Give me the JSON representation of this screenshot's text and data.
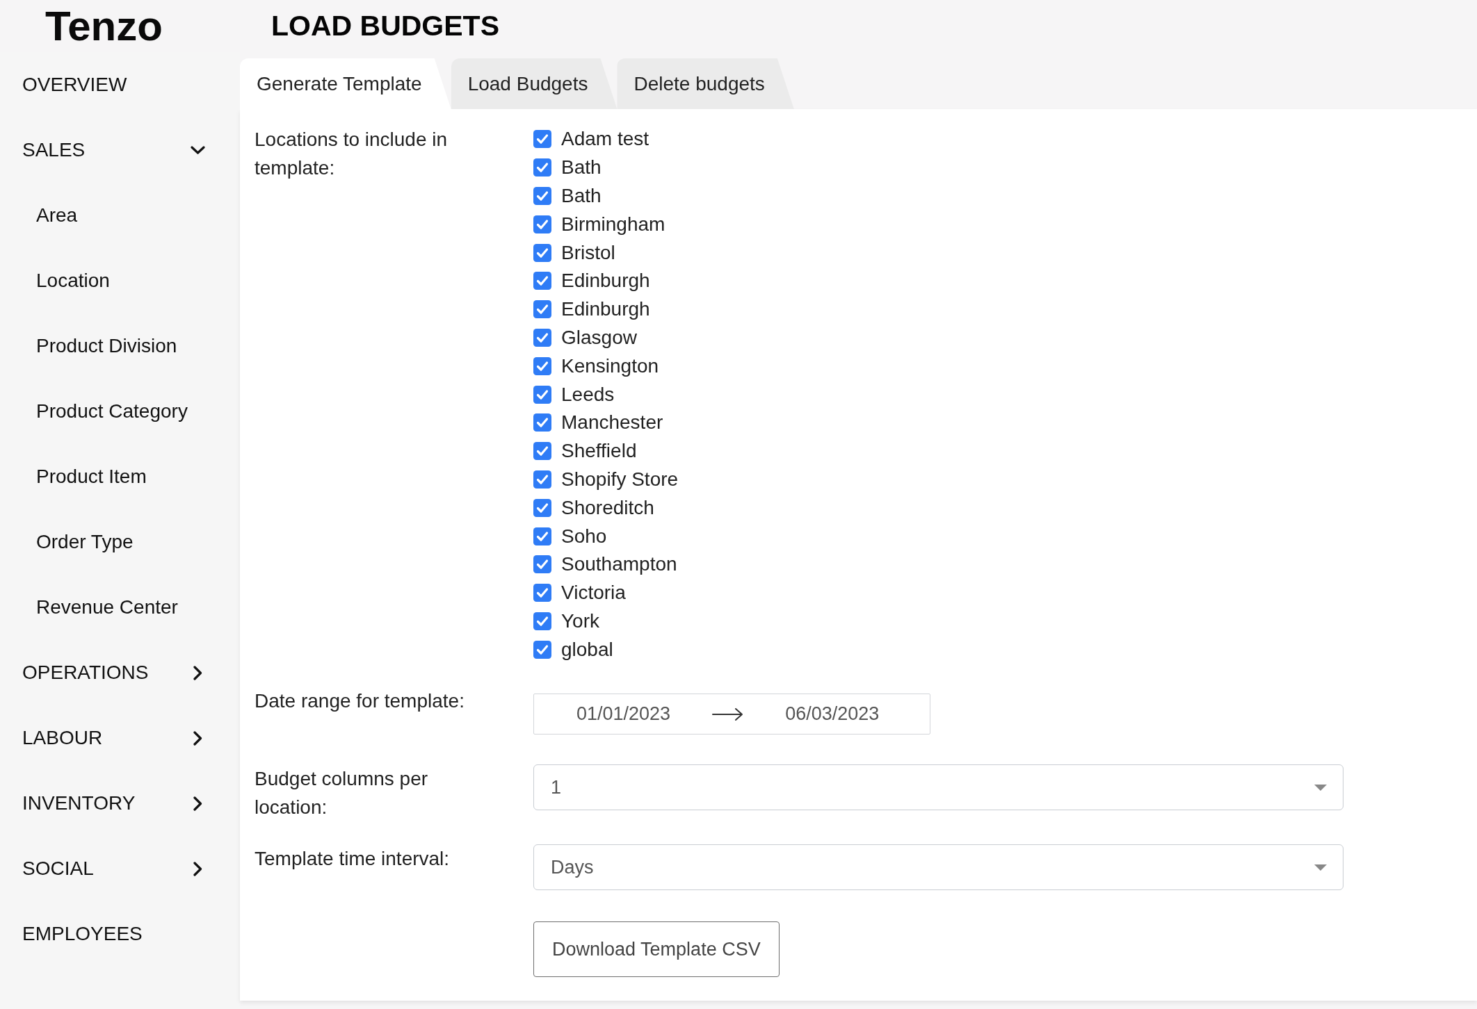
{
  "logo": "Tenzo",
  "page_title": "LOAD BUDGETS",
  "sidebar": {
    "items": [
      {
        "label": "OVERVIEW",
        "kind": "link"
      },
      {
        "label": "SALES",
        "kind": "group",
        "expanded": true,
        "children": [
          {
            "label": "Area"
          },
          {
            "label": "Location"
          },
          {
            "label": "Product Division"
          },
          {
            "label": "Product Category"
          },
          {
            "label": "Product Item"
          },
          {
            "label": "Order Type"
          },
          {
            "label": "Revenue Center"
          }
        ]
      },
      {
        "label": "OPERATIONS",
        "kind": "group",
        "expanded": false
      },
      {
        "label": "LABOUR",
        "kind": "group",
        "expanded": false
      },
      {
        "label": "INVENTORY",
        "kind": "group",
        "expanded": false
      },
      {
        "label": "SOCIAL",
        "kind": "group",
        "expanded": false
      },
      {
        "label": "EMPLOYEES",
        "kind": "link"
      }
    ]
  },
  "tabs": [
    {
      "label": "Generate Template",
      "selected": true
    },
    {
      "label": "Load Budgets",
      "selected": false
    },
    {
      "label": "Delete budgets",
      "selected": false
    }
  ],
  "form": {
    "locations": {
      "label": "Locations to include in template:",
      "options": [
        {
          "name": "Adam test",
          "checked": true
        },
        {
          "name": "Bath",
          "checked": true
        },
        {
          "name": "Bath",
          "checked": true
        },
        {
          "name": "Birmingham",
          "checked": true
        },
        {
          "name": "Bristol",
          "checked": true
        },
        {
          "name": "Edinburgh",
          "checked": true
        },
        {
          "name": "Edinburgh",
          "checked": true
        },
        {
          "name": "Glasgow",
          "checked": true
        },
        {
          "name": "Kensington",
          "checked": true
        },
        {
          "name": "Leeds",
          "checked": true
        },
        {
          "name": "Manchester",
          "checked": true
        },
        {
          "name": "Sheffield",
          "checked": true
        },
        {
          "name": "Shopify Store",
          "checked": true
        },
        {
          "name": "Shoreditch",
          "checked": true
        },
        {
          "name": "Soho",
          "checked": true
        },
        {
          "name": "Southampton",
          "checked": true
        },
        {
          "name": "Victoria",
          "checked": true
        },
        {
          "name": "York",
          "checked": true
        },
        {
          "name": "global",
          "checked": true
        }
      ]
    },
    "date_range": {
      "label": "Date range for template:",
      "start": "01/01/2023",
      "end": "06/03/2023"
    },
    "budget_columns": {
      "label": "Budget columns per location:",
      "value": "1"
    },
    "time_interval": {
      "label": "Template time interval:",
      "value": "Days"
    },
    "download_button": "Download Template CSV"
  }
}
